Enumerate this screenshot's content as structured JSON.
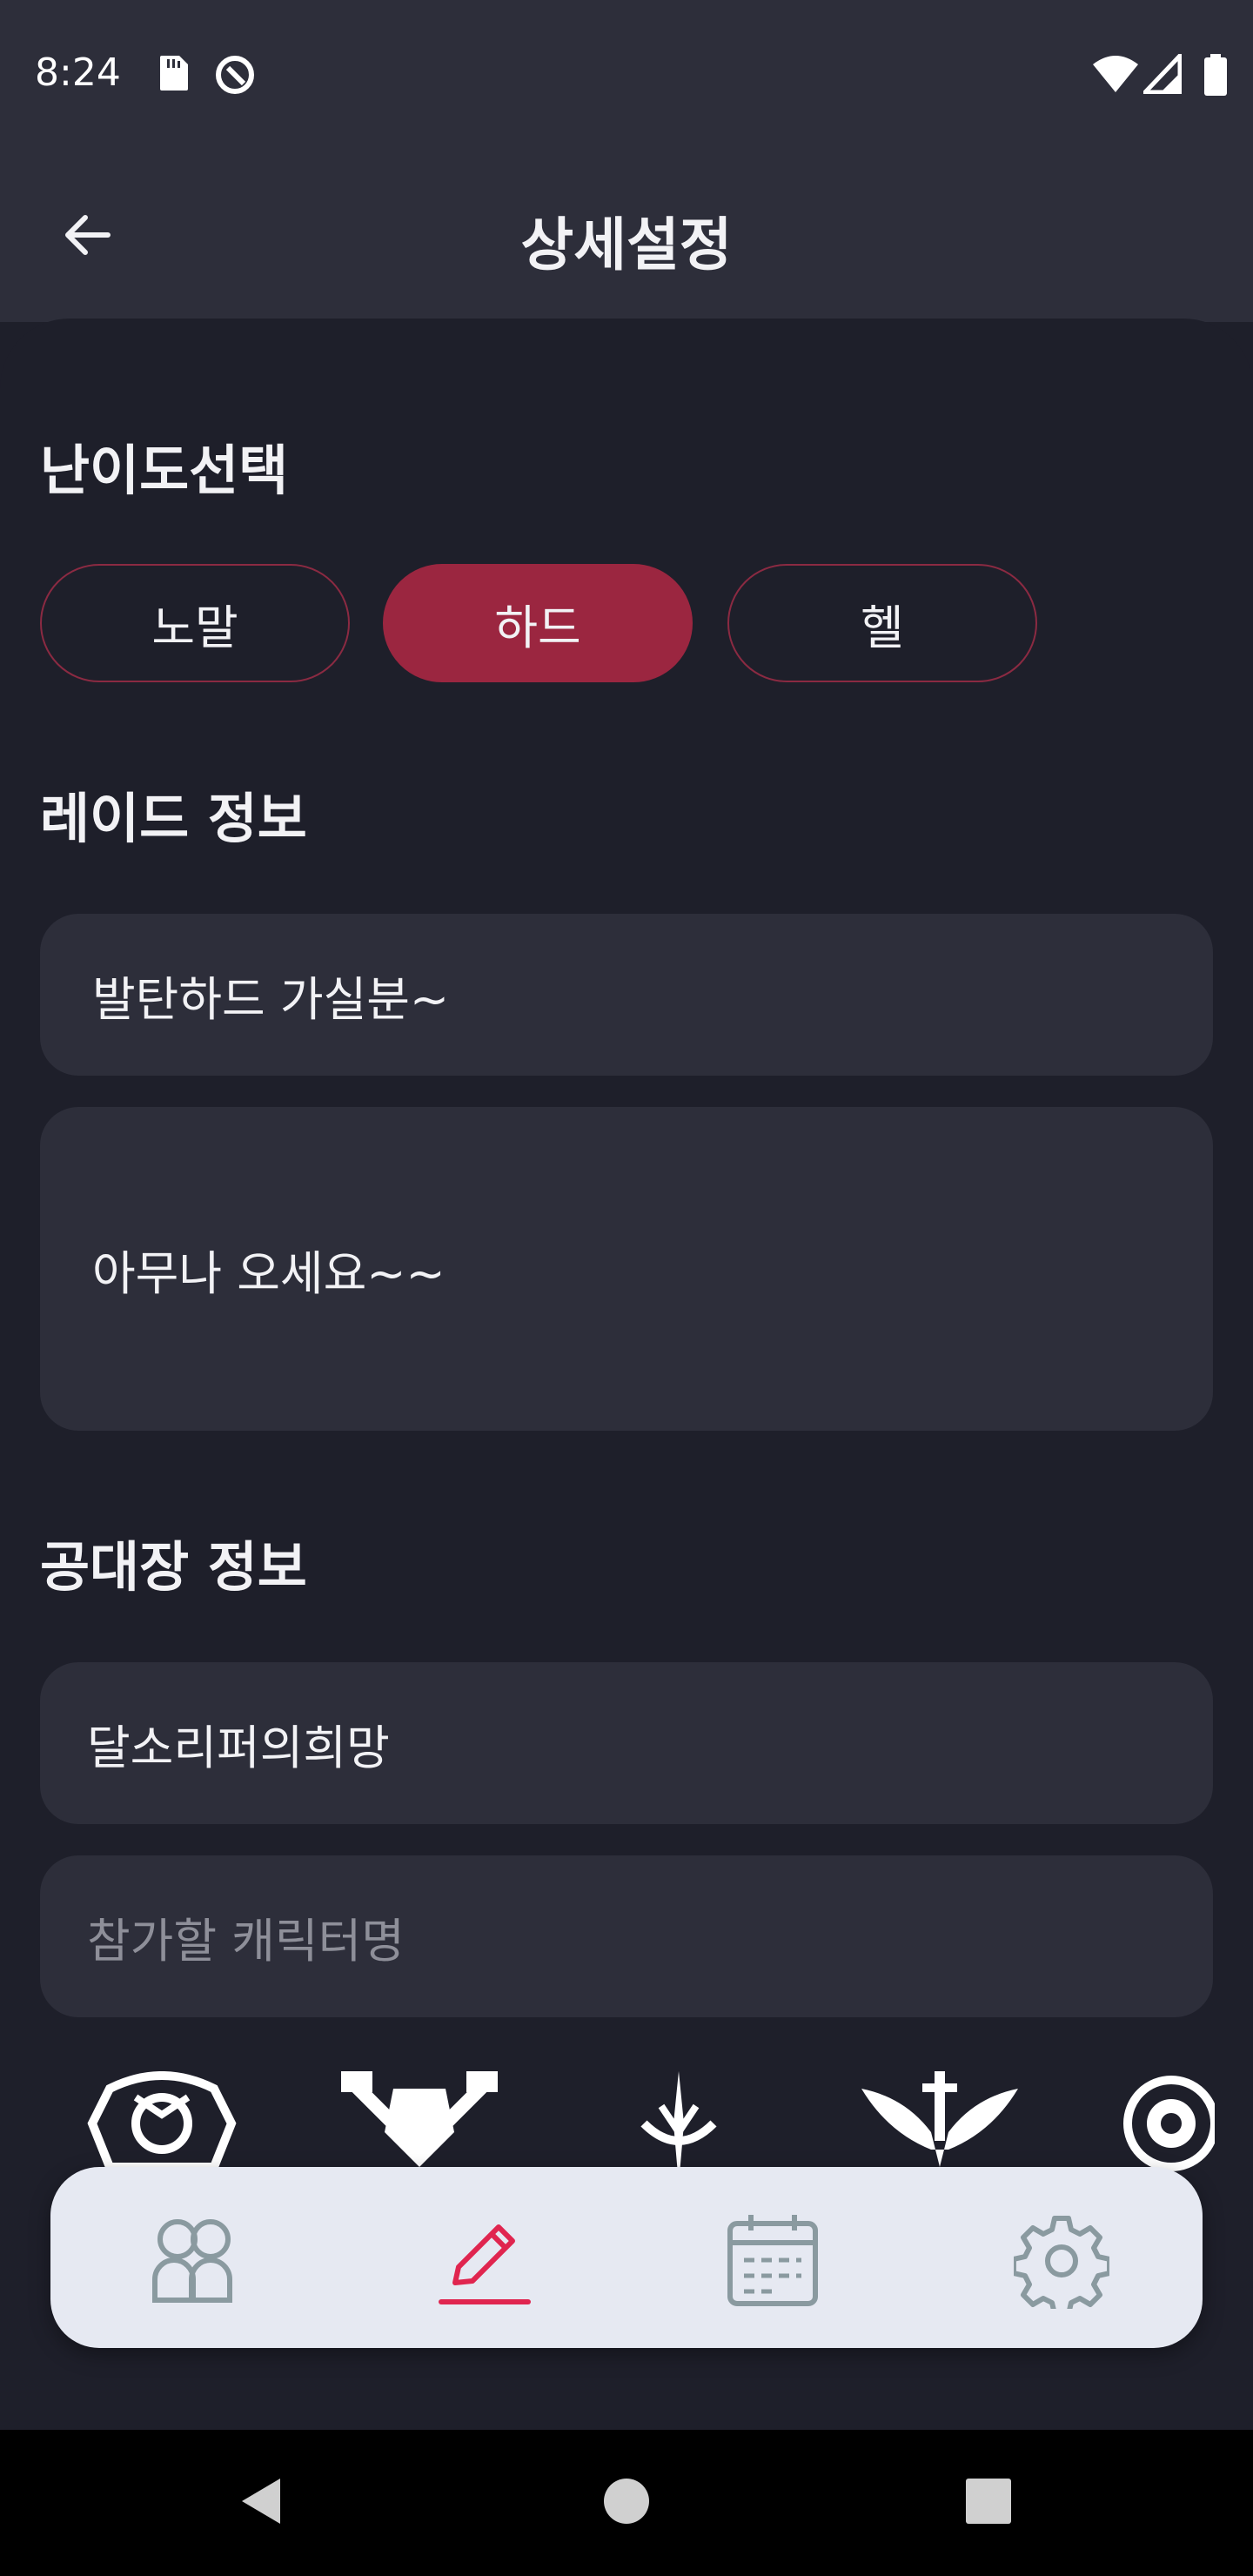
{
  "status": {
    "time": "8:24"
  },
  "appbar": {
    "title": "상세설정"
  },
  "difficulty": {
    "title": "난이도선택",
    "options": [
      {
        "label": "노말",
        "selected": false
      },
      {
        "label": "하드",
        "selected": true
      },
      {
        "label": "헬",
        "selected": false
      }
    ]
  },
  "raid": {
    "title": "레이드 정보",
    "name_value": "발탄하드 가실분~",
    "description_value": "아무나 오세요~~"
  },
  "leader": {
    "title": "공대장 정보",
    "name_value": "달소리퍼의희망",
    "character_placeholder": "참가할 캐릭터명"
  },
  "emblems": [
    "crest-1",
    "crest-2",
    "crest-3",
    "crest-4",
    "crest-5"
  ],
  "bottom_nav": {
    "items": [
      {
        "icon": "party-icon",
        "active": false
      },
      {
        "icon": "pencil-icon",
        "active": true
      },
      {
        "icon": "calendar-icon",
        "active": false
      },
      {
        "icon": "gear-icon",
        "active": false
      }
    ]
  },
  "colors": {
    "accent": "#9b2640",
    "background": "#1e1f2a",
    "surface": "#2d2e3a",
    "nav_active": "#e0254f"
  }
}
